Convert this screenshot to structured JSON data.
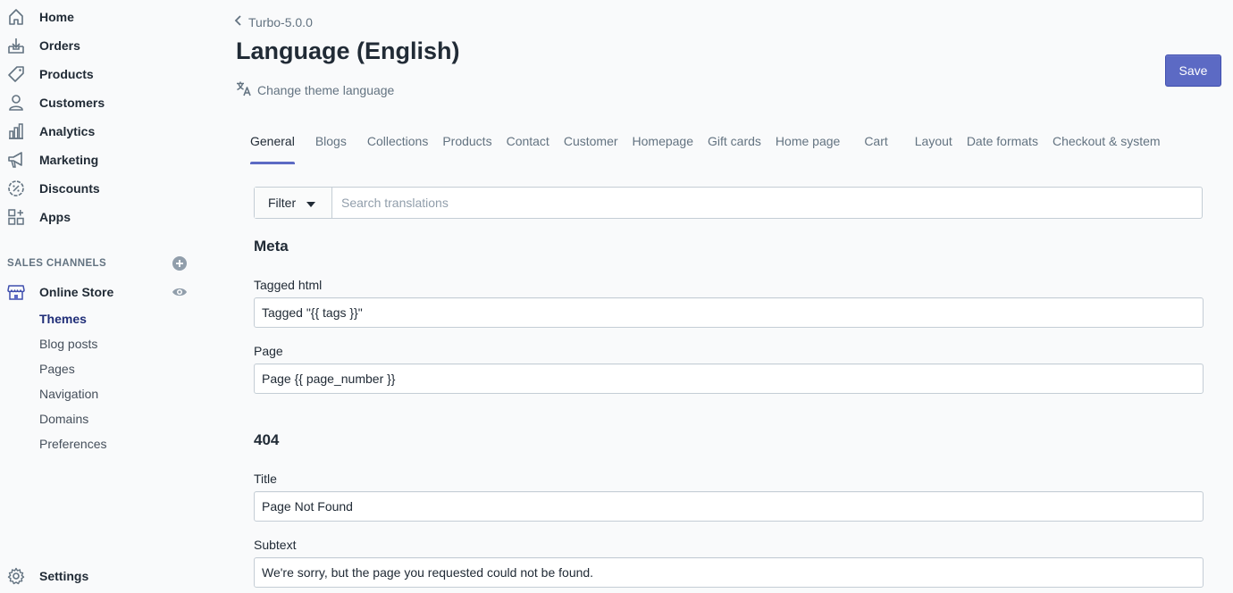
{
  "sidebar": {
    "nav": [
      {
        "label": "Home",
        "icon": "home-icon"
      },
      {
        "label": "Orders",
        "icon": "orders-icon"
      },
      {
        "label": "Products",
        "icon": "tag-icon"
      },
      {
        "label": "Customers",
        "icon": "person-icon"
      },
      {
        "label": "Analytics",
        "icon": "bar-chart-icon"
      },
      {
        "label": "Marketing",
        "icon": "megaphone-icon"
      },
      {
        "label": "Discounts",
        "icon": "discount-icon"
      },
      {
        "label": "Apps",
        "icon": "apps-icon"
      }
    ],
    "sales_channels_heading": "SALES CHANNELS",
    "online_store": {
      "label": "Online Store",
      "icon": "store-icon"
    },
    "sub_items": [
      "Themes",
      "Blog posts",
      "Pages",
      "Navigation",
      "Domains",
      "Preferences"
    ],
    "settings_label": "Settings"
  },
  "header": {
    "breadcrumb": "Turbo-5.0.0",
    "title": "Language (English)",
    "sub_action": "Change theme language",
    "save_label": "Save"
  },
  "tabs": [
    "General",
    "Blogs",
    "Collections",
    "Products",
    "Contact",
    "Customer",
    "Homepage",
    "Gift cards",
    "Home page",
    "Cart",
    "Layout",
    "Date formats",
    "Checkout & system"
  ],
  "filter": {
    "button_label": "Filter",
    "search_placeholder": "Search translations"
  },
  "sections": {
    "meta": {
      "heading": "Meta",
      "fields": [
        {
          "label": "Tagged html",
          "value": "Tagged \"{{ tags }}\""
        },
        {
          "label": "Page",
          "value": "Page {{ page_number }}"
        }
      ]
    },
    "notfound": {
      "heading": "404",
      "fields": [
        {
          "label": "Title",
          "value": "Page Not Found"
        },
        {
          "label": "Subtext",
          "value": "We're sorry, but the page you requested could not be found."
        }
      ]
    }
  },
  "colors": {
    "accent": "#5c6ac4",
    "active_sub": "#202e78",
    "text": "#212b36",
    "muted": "#637381"
  }
}
